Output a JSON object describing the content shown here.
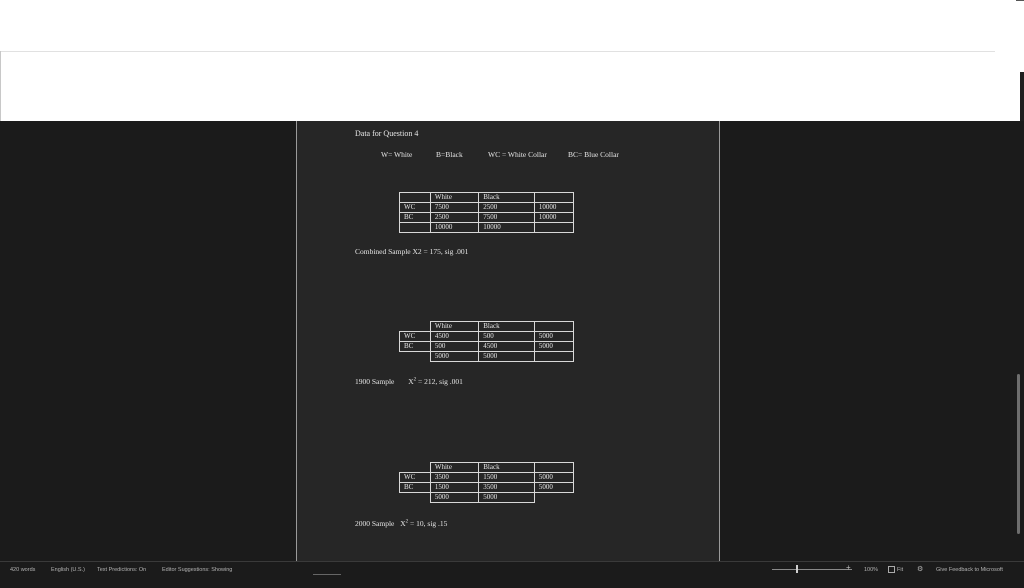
{
  "document": {
    "heading": "Data for Question 4",
    "legend": [
      "W= White",
      "B=Black",
      "WC = White Collar",
      "BC= Blue Collar"
    ],
    "tables": [
      {
        "header": [
          "",
          "White",
          "Black",
          ""
        ],
        "rows": [
          [
            "WC",
            "7500",
            "2500",
            "10000"
          ],
          [
            "BC",
            "2500",
            "7500",
            "10000"
          ]
        ],
        "footer": [
          "",
          "10000",
          "10000",
          ""
        ]
      },
      {
        "header": [
          "",
          "White",
          "Black",
          ""
        ],
        "rows": [
          [
            "WC",
            "4500",
            "500",
            "5000"
          ],
          [
            "BC",
            "500",
            "4500",
            "5000"
          ]
        ],
        "footer": [
          "",
          "5000",
          "5000",
          ""
        ]
      },
      {
        "header": [
          "",
          "White",
          "Black",
          ""
        ],
        "rows": [
          [
            "WC",
            "3500",
            "1500",
            "5000"
          ],
          [
            "BC",
            "1500",
            "3500",
            "5000"
          ]
        ],
        "footer": [
          "",
          "5000",
          "5000",
          ""
        ]
      }
    ],
    "results": [
      {
        "label": "Combined Sample",
        "stat": "X2 = 175, sig .001"
      },
      {
        "label": "1900 Sample",
        "stat_prefix": "X",
        "stat_sup": "2",
        "stat_rest": " = 212, sig .001"
      },
      {
        "label": "2000 Sample",
        "stat_prefix": "X",
        "stat_sup": "2",
        "stat_rest": " = 10, sig .15"
      }
    ]
  },
  "status_bar": {
    "words": "420 words",
    "language": "English (U.S.)",
    "text_predictions": "Text Predictions: On",
    "editor_suggestions": "Editor Suggestions: Showing",
    "zoom": "100%",
    "fit": "Fit",
    "feedback": "Give Feedback to Microsoft"
  },
  "icons": [
    "fit-to-width-icon",
    "focus-icon",
    "zoom-slider"
  ]
}
